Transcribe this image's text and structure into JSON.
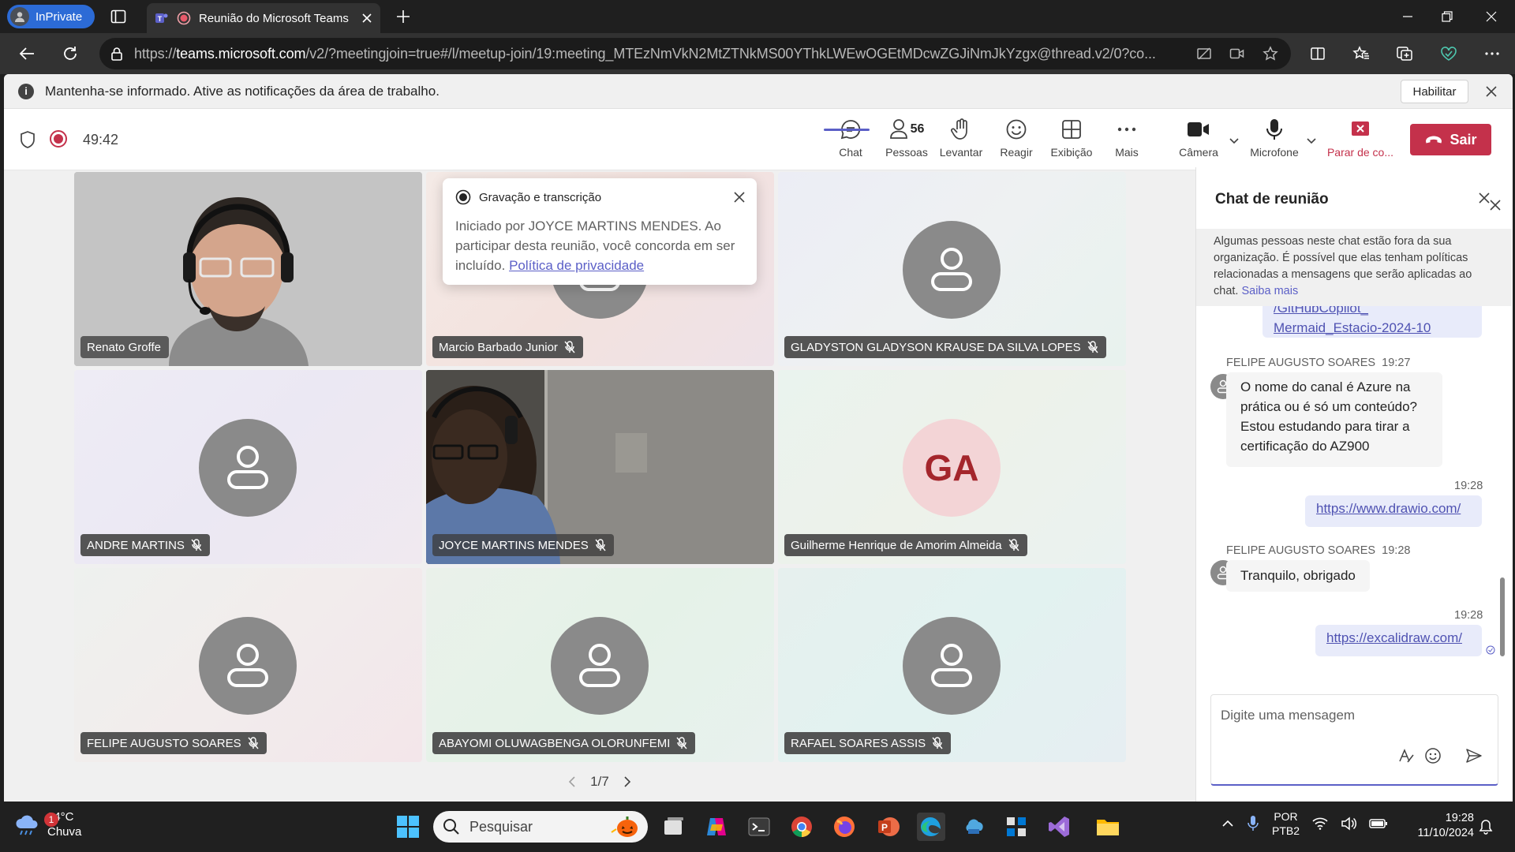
{
  "browser": {
    "inprivate_label": "InPrivate",
    "tab_title": "Reunião do Microsoft Teams",
    "url_prefix": "https://",
    "url_host": "teams.microsoft.com",
    "url_path": "/v2/?meetingjoin=true#/l/meetup-join/19:meeting_MTEzNmVkN2MtZTNkMS00YThkLWEwOGEtMDcwZGJiNmJkYzgx@thread.v2/0?co..."
  },
  "notification": {
    "text": "Mantenha-se informado. Ative as notificações da área de trabalho.",
    "enable_label": "Habilitar"
  },
  "meeting": {
    "timer": "49:42",
    "chat_label": "Chat",
    "people_label": "Pessoas",
    "people_count": "56",
    "raise_label": "Levantar",
    "react_label": "Reagir",
    "view_label": "Exibição",
    "more_label": "Mais",
    "camera_label": "Câmera",
    "mic_label": "Microfone",
    "stop_label": "Parar de co...",
    "leave_label": "Sair"
  },
  "participants": [
    {
      "name": "Renato Groffe",
      "video": true,
      "muted": false
    },
    {
      "name": "Marcio Barbado Junior",
      "video": false,
      "muted": true
    },
    {
      "name": "GLADYSTON GLADYSON KRAUSE DA SILVA LOPES",
      "video": false,
      "muted": true
    },
    {
      "name": "ANDRE MARTINS",
      "video": false,
      "muted": true
    },
    {
      "name": "JOYCE MARTINS MENDES",
      "video": true,
      "muted": true
    },
    {
      "name": "Guilherme Henrique de Amorim Almeida",
      "video": false,
      "muted": true,
      "initials": "GA"
    },
    {
      "name": "FELIPE AUGUSTO SOARES",
      "video": false,
      "muted": true
    },
    {
      "name": "ABAYOMI OLUWAGBENGA OLORUNFEMI",
      "video": false,
      "muted": true
    },
    {
      "name": "RAFAEL SOARES ASSIS",
      "video": false,
      "muted": true
    }
  ],
  "recording_toast": {
    "title": "Gravação e transcrição",
    "body": "Iniciado por JOYCE MARTINS MENDES. Ao participar desta reunião, você concorda em ser incluído.",
    "link": "Política de privacidade"
  },
  "pager": {
    "label": "1/7"
  },
  "chat": {
    "title": "Chat de reunião",
    "warning": "Algumas pessoas neste chat estão fora da sua organização. É possível que elas tenham políticas relacionadas a mensagens que serão aplicadas ao chat.",
    "warning_link": "Saiba mais",
    "cut_link_1": "/GitHubCopilot_",
    "cut_link_2": "Mermaid_Estacio-2024-10",
    "m1_sender": "FELIPE AUGUSTO SOARES",
    "m1_time": "19:27",
    "m1_text": "O nome do canal é Azure na prática ou é só um conteúdo? Estou estudando para tirar a certificação do AZ900",
    "m2_time": "19:28",
    "m2_link": "https://www.drawio.com/",
    "m3_sender": "FELIPE AUGUSTO SOARES",
    "m3_time": "19:28",
    "m3_text": "Tranquilo, obrigado",
    "m4_time": "19:28",
    "m4_link": "https://excalidraw.com/",
    "composer_placeholder": "Digite uma mensagem"
  },
  "taskbar": {
    "weather_temp": "24°C",
    "weather_desc": "Chuva",
    "weather_badge": "1",
    "search_placeholder": "Pesquisar",
    "lang_1": "POR",
    "lang_2": "PTB2",
    "time": "19:28",
    "date": "11/10/2024"
  }
}
